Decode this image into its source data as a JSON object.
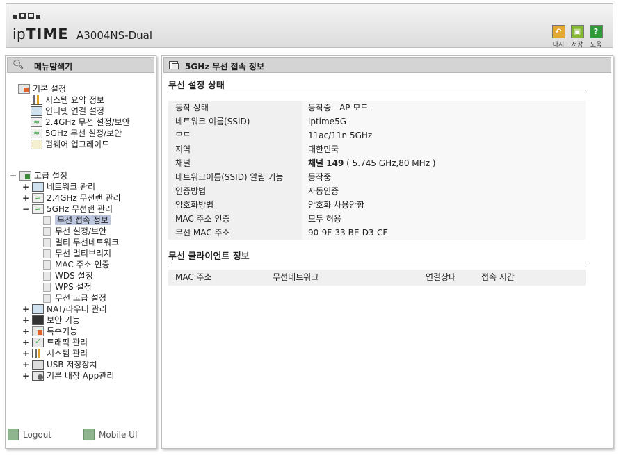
{
  "header": {
    "logo_ip": "ip",
    "logo_time": "TIME",
    "model": "A3004NS-Dual",
    "buttons": {
      "undo": "다시",
      "save": "저장",
      "help": "도움"
    },
    "help_icon": "?"
  },
  "left": {
    "title": "메뉴탐색기",
    "basic": {
      "label": "기본 설정",
      "items": [
        {
          "label": "시스템 요약 정보",
          "icon": "bars-icon"
        },
        {
          "label": "인터넷 연결 설정",
          "icon": "monitor-icon"
        },
        {
          "label": "2.4GHz 무선 설정/보안",
          "icon": "wifi-icon"
        },
        {
          "label": "5GHz 무선 설정/보안",
          "icon": "wifi-icon"
        },
        {
          "label": "펌웨어 업그레이드",
          "icon": "upgrade-icon"
        }
      ]
    },
    "advanced": {
      "expander": "−",
      "label": "고급 설정",
      "items": [
        {
          "exp": "+",
          "label": "네트워크 관리"
        },
        {
          "exp": "+",
          "label": "2.4GHz 무선랜 관리"
        },
        {
          "exp": "−",
          "label": "5GHz 무선랜 관리"
        }
      ],
      "sub_5ghz": [
        "무선 접속 정보",
        "무선 설정/보안",
        "멀티 무선네트워크",
        "무선 멀티브리지",
        "MAC 주소 인증",
        "WDS 설정",
        "WPS 설정",
        "무선 고급 설정"
      ],
      "more": [
        {
          "exp": "+",
          "label": "NAT/라우터 관리"
        },
        {
          "exp": "+",
          "label": "보안 기능"
        },
        {
          "exp": "+",
          "label": "특수기능"
        },
        {
          "exp": "+",
          "label": "트래픽 관리"
        },
        {
          "exp": "+",
          "label": "시스템 관리"
        },
        {
          "exp": "+",
          "label": "USB 저장장치"
        },
        {
          "exp": "+",
          "label": "기본 내장 App관리"
        }
      ]
    },
    "footer": {
      "logout": "Logout",
      "mobile": "Mobile UI"
    }
  },
  "right": {
    "title": "5GHz 무선 접속 정보",
    "status_title": "무선 설정 상태",
    "rows": [
      {
        "k": "동작 상태",
        "v": "동작중 - AP 모드"
      },
      {
        "k": "네트워크 이름(SSID)",
        "v": "iptime5G"
      },
      {
        "k": "모드",
        "v": "11ac/11n 5GHz"
      },
      {
        "k": "지역",
        "v": "대한민국"
      },
      {
        "k": "채널",
        "v_bold": "채널 149",
        "v": " ( 5.745 GHz,80 MHz )"
      },
      {
        "k": "네트워크이름(SSID) 알림 기능",
        "v": "동작중"
      },
      {
        "k": "인증방법",
        "v": "자동인증"
      },
      {
        "k": "암호화방법",
        "v": "암호화 사용안함"
      },
      {
        "k": "MAC 주소 인증",
        "v": "모두 허용"
      },
      {
        "k": "무선 MAC 주소",
        "v": "90-9F-33-BE-D3-CE"
      }
    ],
    "client_title": "무선 클라이언트 정보",
    "client_headers": [
      "MAC 주소",
      "무선네트워크",
      "연결상태",
      "접속 시간"
    ]
  }
}
